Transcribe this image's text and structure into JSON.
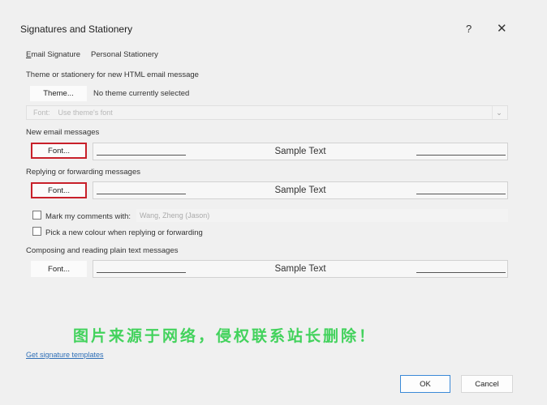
{
  "dialog": {
    "title": "Signatures and Stationery",
    "help": "?",
    "close": "✕"
  },
  "tabs": {
    "email_signature": "Email Signature",
    "personal_stationery": "Personal Stationery"
  },
  "theme": {
    "section_label": "Theme or stationery for new HTML email message",
    "button": "Theme...",
    "status": "No theme currently selected",
    "font_label": "Font:",
    "font_value": "Use theme's font"
  },
  "new_messages": {
    "section_label": "New email messages",
    "font_button": "Font...",
    "sample": "Sample Text"
  },
  "replying": {
    "section_label": "Replying or forwarding messages",
    "font_button": "Font...",
    "sample": "Sample Text",
    "mark_comments_label": "Mark my comments with:",
    "mark_comments_value": "Wang, Zheng (Jason)",
    "new_colour_label": "Pick a new colour when replying or forwarding"
  },
  "plain_text": {
    "section_label": "Composing and reading plain text messages",
    "font_button": "Font...",
    "sample": "Sample Text"
  },
  "watermark": "图片来源于网络，侵权联系站长删除！",
  "footer": {
    "templates_link": "Get signature templates",
    "ok": "OK",
    "cancel": "Cancel"
  },
  "colors": {
    "highlight_border": "#c8202a",
    "link": "#2f6fb7",
    "watermark": "#42d25c",
    "ok_border": "#3b8ad8"
  }
}
